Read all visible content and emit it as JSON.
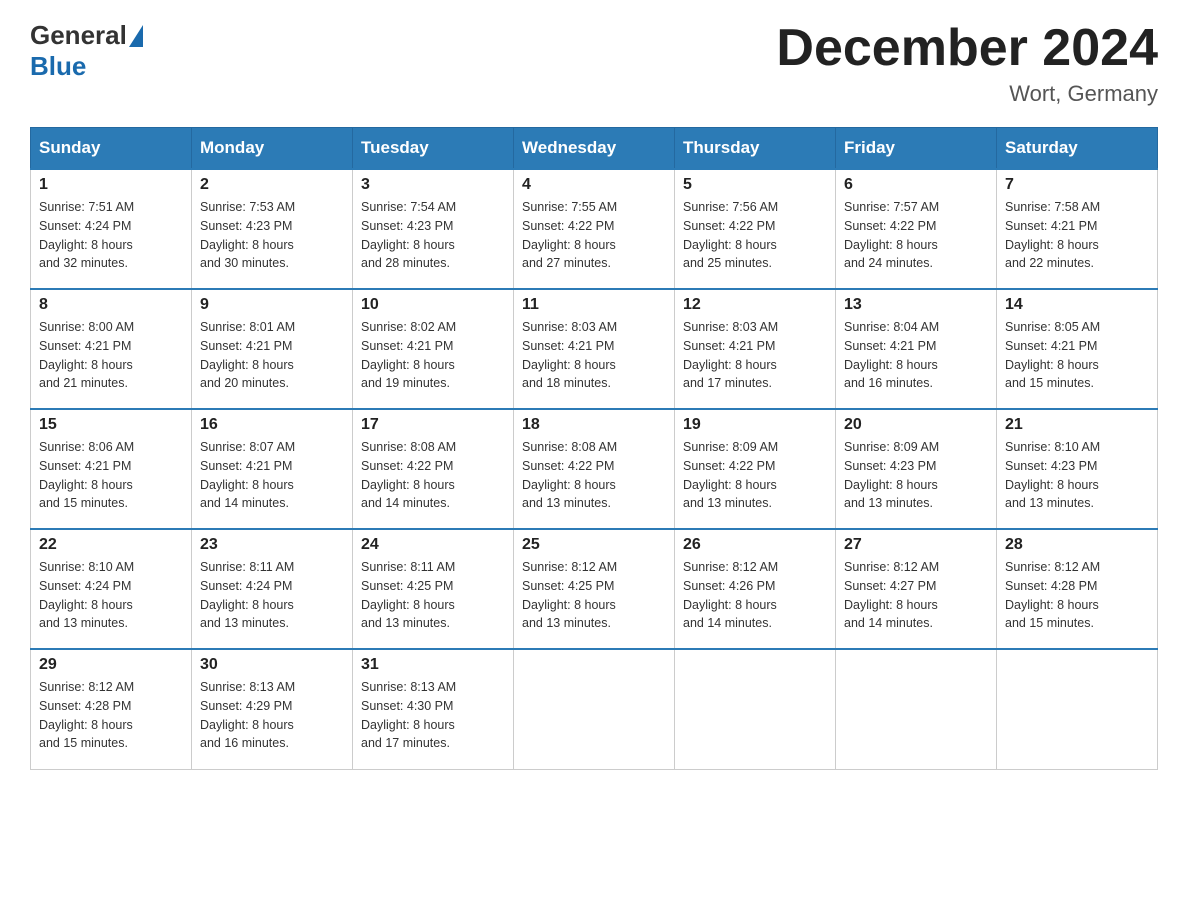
{
  "header": {
    "logo_general": "General",
    "logo_blue": "Blue",
    "title": "December 2024",
    "subtitle": "Wort, Germany"
  },
  "weekdays": [
    "Sunday",
    "Monday",
    "Tuesday",
    "Wednesday",
    "Thursday",
    "Friday",
    "Saturday"
  ],
  "weeks": [
    [
      {
        "day": "1",
        "sunrise": "7:51 AM",
        "sunset": "4:24 PM",
        "daylight": "8 hours and 32 minutes."
      },
      {
        "day": "2",
        "sunrise": "7:53 AM",
        "sunset": "4:23 PM",
        "daylight": "8 hours and 30 minutes."
      },
      {
        "day": "3",
        "sunrise": "7:54 AM",
        "sunset": "4:23 PM",
        "daylight": "8 hours and 28 minutes."
      },
      {
        "day": "4",
        "sunrise": "7:55 AM",
        "sunset": "4:22 PM",
        "daylight": "8 hours and 27 minutes."
      },
      {
        "day": "5",
        "sunrise": "7:56 AM",
        "sunset": "4:22 PM",
        "daylight": "8 hours and 25 minutes."
      },
      {
        "day": "6",
        "sunrise": "7:57 AM",
        "sunset": "4:22 PM",
        "daylight": "8 hours and 24 minutes."
      },
      {
        "day": "7",
        "sunrise": "7:58 AM",
        "sunset": "4:21 PM",
        "daylight": "8 hours and 22 minutes."
      }
    ],
    [
      {
        "day": "8",
        "sunrise": "8:00 AM",
        "sunset": "4:21 PM",
        "daylight": "8 hours and 21 minutes."
      },
      {
        "day": "9",
        "sunrise": "8:01 AM",
        "sunset": "4:21 PM",
        "daylight": "8 hours and 20 minutes."
      },
      {
        "day": "10",
        "sunrise": "8:02 AM",
        "sunset": "4:21 PM",
        "daylight": "8 hours and 19 minutes."
      },
      {
        "day": "11",
        "sunrise": "8:03 AM",
        "sunset": "4:21 PM",
        "daylight": "8 hours and 18 minutes."
      },
      {
        "day": "12",
        "sunrise": "8:03 AM",
        "sunset": "4:21 PM",
        "daylight": "8 hours and 17 minutes."
      },
      {
        "day": "13",
        "sunrise": "8:04 AM",
        "sunset": "4:21 PM",
        "daylight": "8 hours and 16 minutes."
      },
      {
        "day": "14",
        "sunrise": "8:05 AM",
        "sunset": "4:21 PM",
        "daylight": "8 hours and 15 minutes."
      }
    ],
    [
      {
        "day": "15",
        "sunrise": "8:06 AM",
        "sunset": "4:21 PM",
        "daylight": "8 hours and 15 minutes."
      },
      {
        "day": "16",
        "sunrise": "8:07 AM",
        "sunset": "4:21 PM",
        "daylight": "8 hours and 14 minutes."
      },
      {
        "day": "17",
        "sunrise": "8:08 AM",
        "sunset": "4:22 PM",
        "daylight": "8 hours and 14 minutes."
      },
      {
        "day": "18",
        "sunrise": "8:08 AM",
        "sunset": "4:22 PM",
        "daylight": "8 hours and 13 minutes."
      },
      {
        "day": "19",
        "sunrise": "8:09 AM",
        "sunset": "4:22 PM",
        "daylight": "8 hours and 13 minutes."
      },
      {
        "day": "20",
        "sunrise": "8:09 AM",
        "sunset": "4:23 PM",
        "daylight": "8 hours and 13 minutes."
      },
      {
        "day": "21",
        "sunrise": "8:10 AM",
        "sunset": "4:23 PM",
        "daylight": "8 hours and 13 minutes."
      }
    ],
    [
      {
        "day": "22",
        "sunrise": "8:10 AM",
        "sunset": "4:24 PM",
        "daylight": "8 hours and 13 minutes."
      },
      {
        "day": "23",
        "sunrise": "8:11 AM",
        "sunset": "4:24 PM",
        "daylight": "8 hours and 13 minutes."
      },
      {
        "day": "24",
        "sunrise": "8:11 AM",
        "sunset": "4:25 PM",
        "daylight": "8 hours and 13 minutes."
      },
      {
        "day": "25",
        "sunrise": "8:12 AM",
        "sunset": "4:25 PM",
        "daylight": "8 hours and 13 minutes."
      },
      {
        "day": "26",
        "sunrise": "8:12 AM",
        "sunset": "4:26 PM",
        "daylight": "8 hours and 14 minutes."
      },
      {
        "day": "27",
        "sunrise": "8:12 AM",
        "sunset": "4:27 PM",
        "daylight": "8 hours and 14 minutes."
      },
      {
        "day": "28",
        "sunrise": "8:12 AM",
        "sunset": "4:28 PM",
        "daylight": "8 hours and 15 minutes."
      }
    ],
    [
      {
        "day": "29",
        "sunrise": "8:12 AM",
        "sunset": "4:28 PM",
        "daylight": "8 hours and 15 minutes."
      },
      {
        "day": "30",
        "sunrise": "8:13 AM",
        "sunset": "4:29 PM",
        "daylight": "8 hours and 16 minutes."
      },
      {
        "day": "31",
        "sunrise": "8:13 AM",
        "sunset": "4:30 PM",
        "daylight": "8 hours and 17 minutes."
      },
      null,
      null,
      null,
      null
    ]
  ],
  "labels": {
    "sunrise": "Sunrise:",
    "sunset": "Sunset:",
    "daylight": "Daylight:"
  }
}
